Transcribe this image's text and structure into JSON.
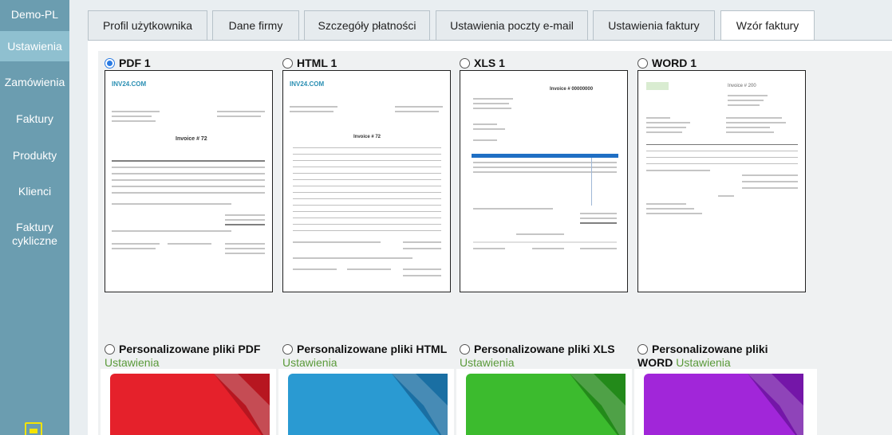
{
  "sidebar": {
    "items": [
      {
        "label": "Demo-PL"
      },
      {
        "label": "Ustawienia"
      },
      {
        "label": "Zamówienia"
      },
      {
        "label": "Faktury"
      },
      {
        "label": "Produkty"
      },
      {
        "label": "Klienci"
      },
      {
        "label": "Faktury cykliczne"
      }
    ],
    "active_color": "#8fc0d0",
    "bg_color": "#6b9db0"
  },
  "tabs": [
    {
      "label": "Profil użytkownika"
    },
    {
      "label": "Dane firmy"
    },
    {
      "label": "Szczegóły płatności"
    },
    {
      "label": "Ustawienia poczty e-mail"
    },
    {
      "label": "Ustawienia faktury"
    },
    {
      "label": "Wzór faktury"
    }
  ],
  "templates": [
    {
      "label": "PDF 1",
      "selected": true,
      "preview_title": "Invoice # 72",
      "logo": "INV24.COM"
    },
    {
      "label": "HTML 1",
      "selected": false,
      "preview_title": "Invoice # 72",
      "logo": "INV24.COM"
    },
    {
      "label": "XLS 1",
      "selected": false,
      "preview_title": "Invoice # 00000000",
      "logo": ""
    },
    {
      "label": "WORD 1",
      "selected": false,
      "preview_title": "Invoice # 200",
      "logo": ""
    }
  ],
  "custom": [
    {
      "label": "Personalizowane pliki PDF",
      "link": "Ustawienia",
      "color": "#e5212b"
    },
    {
      "label": "Personalizowane pliki HTML",
      "link": "Ustawienia",
      "color": "#2a9ad2"
    },
    {
      "label": "Personalizowane pliki XLS",
      "link": "Ustawienia",
      "color": "#3cbb2e"
    },
    {
      "label": "Personalizowane pliki",
      "label2": "WORD",
      "link": "Ustawienia",
      "color": "#a126d9"
    }
  ],
  "colors": {
    "link": "#5a9a3a",
    "radio_selected": "#2a7ae2",
    "logout_icon": "#f5e400"
  }
}
